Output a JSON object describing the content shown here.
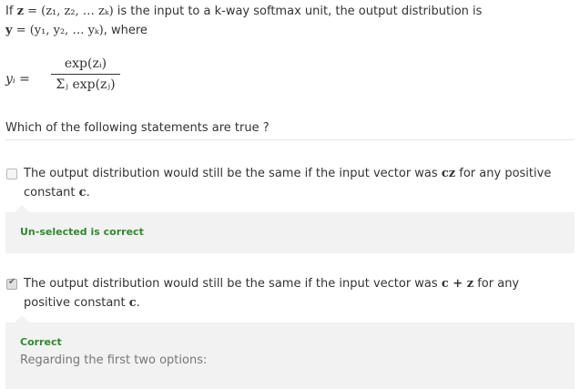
{
  "question": {
    "intro": "If",
    "z_symbol": "z",
    "z_def": "= (z₁, z₂, … zₖ)",
    "mid": "is the input to a k-way softmax unit, the output distribution is",
    "y_symbol": "y",
    "y_def": "= (y₁, y₂, … yₖ)",
    "where": ", where"
  },
  "formula": {
    "lhs": "yᵢ =",
    "numerator": "exp(zᵢ)",
    "denominator": "Σⱼ exp(zⱼ)"
  },
  "prompt": "Which of the following statements are true ?",
  "options": [
    {
      "text_before": "The output distribution would still be the same if the input vector was",
      "math": "cz",
      "text_after": "for any positive",
      "line2_before": "constant",
      "line2_math": "c",
      "line2_after": ".",
      "checked": false,
      "feedback_title": "Un-selected is correct",
      "feedback_body": ""
    },
    {
      "text_before": "The output distribution would still be the same if the input vector was",
      "math": "c + z",
      "text_after": "for any",
      "line2_before": "positive constant",
      "line2_math": "c",
      "line2_after": ".",
      "checked": true,
      "feedback_title": "Correct",
      "feedback_body": "Regarding the first two options:"
    }
  ],
  "colors": {
    "correct": "#2e8b2e",
    "feedback_bg": "#f2f2f2",
    "text": "#333333"
  }
}
